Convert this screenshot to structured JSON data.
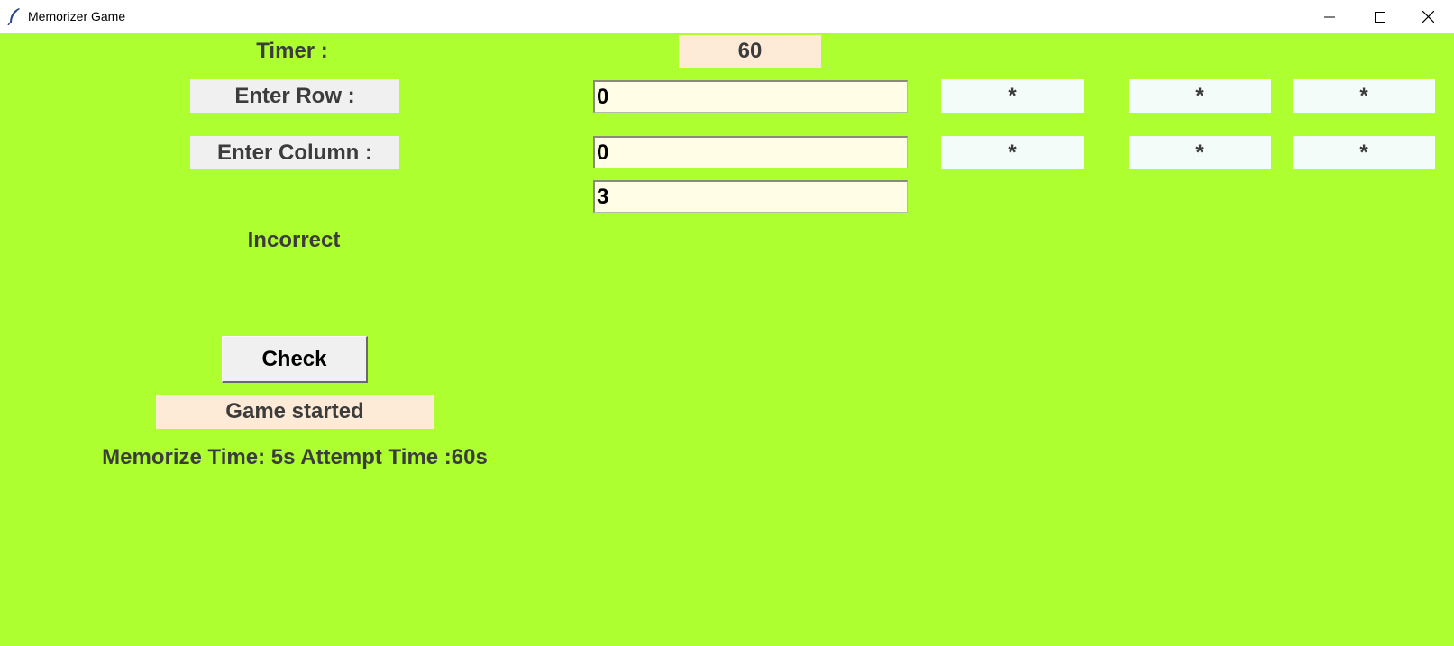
{
  "window": {
    "title": "Memorizer Game",
    "icon": "feather-icon",
    "controls": [
      "minimize-icon",
      "maximize-icon",
      "close-icon"
    ]
  },
  "timer": {
    "label": "Timer :",
    "value": "60"
  },
  "row": {
    "label": "Enter Row :",
    "value": "0"
  },
  "column": {
    "label": "Enter Column :",
    "value": "0"
  },
  "answer": {
    "value": "3"
  },
  "result": {
    "text": "Incorrect"
  },
  "check_button": {
    "label": "Check"
  },
  "status": {
    "text": "Game started"
  },
  "info": {
    "text": "Memorize Time: 5s Attempt Time :60s"
  },
  "grid": {
    "rows": [
      [
        "*",
        "*",
        "*"
      ],
      [
        "*",
        "*",
        "*"
      ]
    ]
  },
  "colors": {
    "background": "#adff2f",
    "label_bg": "#f0f0f0",
    "timer_bg": "#fdebd7",
    "entry_bg": "#fffde6",
    "cell_bg": "#f3fcf8"
  }
}
